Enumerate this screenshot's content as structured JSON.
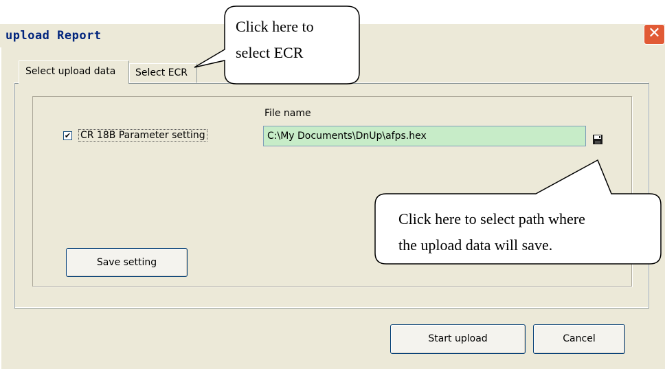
{
  "window": {
    "title": "upload Report",
    "close_symbol": "✕"
  },
  "tabs": [
    {
      "label": "Select upload data",
      "active": true
    },
    {
      "label": "Select ECR",
      "active": false
    }
  ],
  "form": {
    "parameter_checkbox": {
      "label": "CR 18B Parameter setting",
      "checked": true,
      "check_glyph": "✔"
    },
    "file_name_label": "File name",
    "file_path_value": "C:\\My Documents\\DnUp\\afps.hex",
    "browse_icon": "floppy-disk-icon"
  },
  "buttons": {
    "save_setting": "Save setting",
    "start_upload": "Start upload",
    "cancel": "Cancel"
  },
  "callouts": {
    "tab_hint": {
      "line1": "Click here to",
      "line2": "select ECR"
    },
    "path_hint": {
      "line1": "Click here to select path where",
      "line2": "the upload data will save."
    }
  },
  "colors": {
    "accent_close": "#e15a35",
    "input_bg": "#c7ecc8",
    "title_text": "#00247d"
  }
}
